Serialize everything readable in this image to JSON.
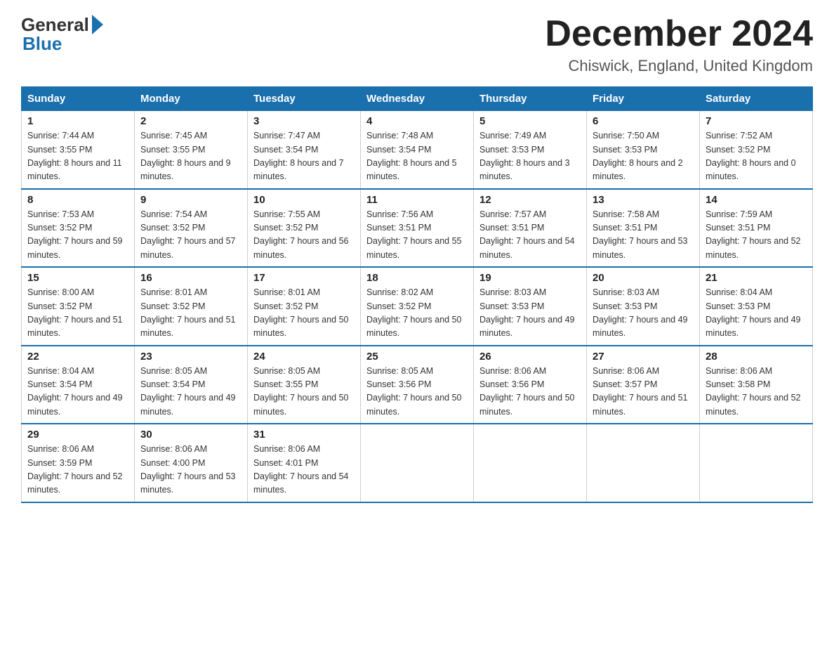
{
  "logo": {
    "general": "General",
    "blue": "Blue"
  },
  "header": {
    "month": "December 2024",
    "location": "Chiswick, England, United Kingdom"
  },
  "days_of_week": [
    "Sunday",
    "Monday",
    "Tuesday",
    "Wednesday",
    "Thursday",
    "Friday",
    "Saturday"
  ],
  "weeks": [
    [
      {
        "day": "1",
        "sunrise": "7:44 AM",
        "sunset": "3:55 PM",
        "daylight": "8 hours and 11 minutes."
      },
      {
        "day": "2",
        "sunrise": "7:45 AM",
        "sunset": "3:55 PM",
        "daylight": "8 hours and 9 minutes."
      },
      {
        "day": "3",
        "sunrise": "7:47 AM",
        "sunset": "3:54 PM",
        "daylight": "8 hours and 7 minutes."
      },
      {
        "day": "4",
        "sunrise": "7:48 AM",
        "sunset": "3:54 PM",
        "daylight": "8 hours and 5 minutes."
      },
      {
        "day": "5",
        "sunrise": "7:49 AM",
        "sunset": "3:53 PM",
        "daylight": "8 hours and 3 minutes."
      },
      {
        "day": "6",
        "sunrise": "7:50 AM",
        "sunset": "3:53 PM",
        "daylight": "8 hours and 2 minutes."
      },
      {
        "day": "7",
        "sunrise": "7:52 AM",
        "sunset": "3:52 PM",
        "daylight": "8 hours and 0 minutes."
      }
    ],
    [
      {
        "day": "8",
        "sunrise": "7:53 AM",
        "sunset": "3:52 PM",
        "daylight": "7 hours and 59 minutes."
      },
      {
        "day": "9",
        "sunrise": "7:54 AM",
        "sunset": "3:52 PM",
        "daylight": "7 hours and 57 minutes."
      },
      {
        "day": "10",
        "sunrise": "7:55 AM",
        "sunset": "3:52 PM",
        "daylight": "7 hours and 56 minutes."
      },
      {
        "day": "11",
        "sunrise": "7:56 AM",
        "sunset": "3:51 PM",
        "daylight": "7 hours and 55 minutes."
      },
      {
        "day": "12",
        "sunrise": "7:57 AM",
        "sunset": "3:51 PM",
        "daylight": "7 hours and 54 minutes."
      },
      {
        "day": "13",
        "sunrise": "7:58 AM",
        "sunset": "3:51 PM",
        "daylight": "7 hours and 53 minutes."
      },
      {
        "day": "14",
        "sunrise": "7:59 AM",
        "sunset": "3:51 PM",
        "daylight": "7 hours and 52 minutes."
      }
    ],
    [
      {
        "day": "15",
        "sunrise": "8:00 AM",
        "sunset": "3:52 PM",
        "daylight": "7 hours and 51 minutes."
      },
      {
        "day": "16",
        "sunrise": "8:01 AM",
        "sunset": "3:52 PM",
        "daylight": "7 hours and 51 minutes."
      },
      {
        "day": "17",
        "sunrise": "8:01 AM",
        "sunset": "3:52 PM",
        "daylight": "7 hours and 50 minutes."
      },
      {
        "day": "18",
        "sunrise": "8:02 AM",
        "sunset": "3:52 PM",
        "daylight": "7 hours and 50 minutes."
      },
      {
        "day": "19",
        "sunrise": "8:03 AM",
        "sunset": "3:53 PM",
        "daylight": "7 hours and 49 minutes."
      },
      {
        "day": "20",
        "sunrise": "8:03 AM",
        "sunset": "3:53 PM",
        "daylight": "7 hours and 49 minutes."
      },
      {
        "day": "21",
        "sunrise": "8:04 AM",
        "sunset": "3:53 PM",
        "daylight": "7 hours and 49 minutes."
      }
    ],
    [
      {
        "day": "22",
        "sunrise": "8:04 AM",
        "sunset": "3:54 PM",
        "daylight": "7 hours and 49 minutes."
      },
      {
        "day": "23",
        "sunrise": "8:05 AM",
        "sunset": "3:54 PM",
        "daylight": "7 hours and 49 minutes."
      },
      {
        "day": "24",
        "sunrise": "8:05 AM",
        "sunset": "3:55 PM",
        "daylight": "7 hours and 50 minutes."
      },
      {
        "day": "25",
        "sunrise": "8:05 AM",
        "sunset": "3:56 PM",
        "daylight": "7 hours and 50 minutes."
      },
      {
        "day": "26",
        "sunrise": "8:06 AM",
        "sunset": "3:56 PM",
        "daylight": "7 hours and 50 minutes."
      },
      {
        "day": "27",
        "sunrise": "8:06 AM",
        "sunset": "3:57 PM",
        "daylight": "7 hours and 51 minutes."
      },
      {
        "day": "28",
        "sunrise": "8:06 AM",
        "sunset": "3:58 PM",
        "daylight": "7 hours and 52 minutes."
      }
    ],
    [
      {
        "day": "29",
        "sunrise": "8:06 AM",
        "sunset": "3:59 PM",
        "daylight": "7 hours and 52 minutes."
      },
      {
        "day": "30",
        "sunrise": "8:06 AM",
        "sunset": "4:00 PM",
        "daylight": "7 hours and 53 minutes."
      },
      {
        "day": "31",
        "sunrise": "8:06 AM",
        "sunset": "4:01 PM",
        "daylight": "7 hours and 54 minutes."
      },
      null,
      null,
      null,
      null
    ]
  ]
}
